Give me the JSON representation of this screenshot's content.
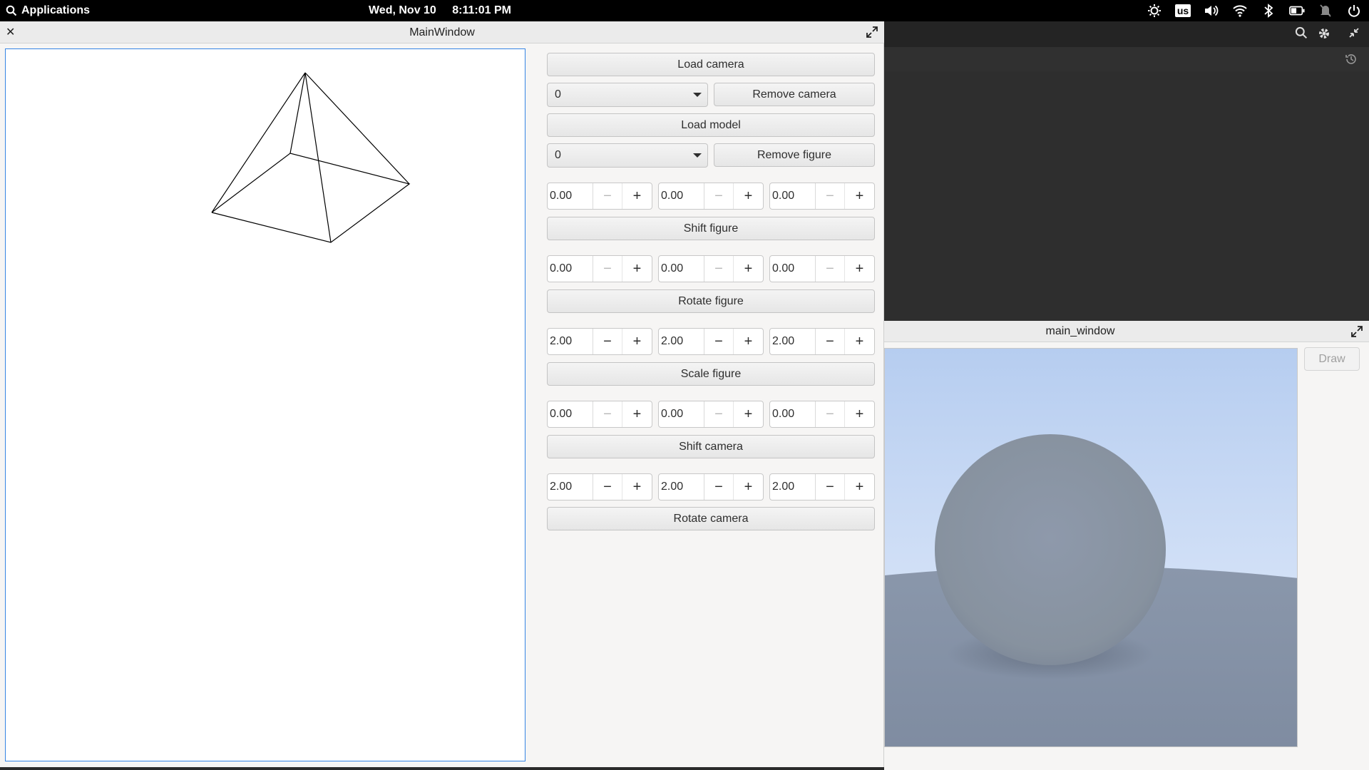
{
  "topbar": {
    "apps_label": "Applications",
    "date": "Wed, Nov 10",
    "time": "8:11:01 PM",
    "keyboard_layout": "us"
  },
  "main_window": {
    "title": "MainWindow",
    "load_camera": "Load camera",
    "camera_select": "0",
    "remove_camera": "Remove camera",
    "load_model": "Load model",
    "figure_select": "0",
    "remove_figure": "Remove figure",
    "shift_figure": {
      "values": [
        "0.00",
        "0.00",
        "0.00"
      ],
      "label": "Shift figure"
    },
    "rotate_figure": {
      "values": [
        "0.00",
        "0.00",
        "0.00"
      ],
      "label": "Rotate figure"
    },
    "scale_figure": {
      "values": [
        "2.00",
        "2.00",
        "2.00"
      ],
      "label": "Scale figure"
    },
    "shift_camera": {
      "values": [
        "0.00",
        "0.00",
        "0.00"
      ],
      "label": "Shift camera"
    },
    "rotate_camera": {
      "values": [
        "2.00",
        "2.00",
        "2.00"
      ],
      "label": "Rotate camera"
    }
  },
  "render_window": {
    "title": "main_window",
    "draw_button": "Draw"
  },
  "colors": {
    "accent": "#3584e4",
    "sky_top": "#b6cdf0",
    "ground": "#8592a8",
    "sphere": "#8a96a8"
  }
}
